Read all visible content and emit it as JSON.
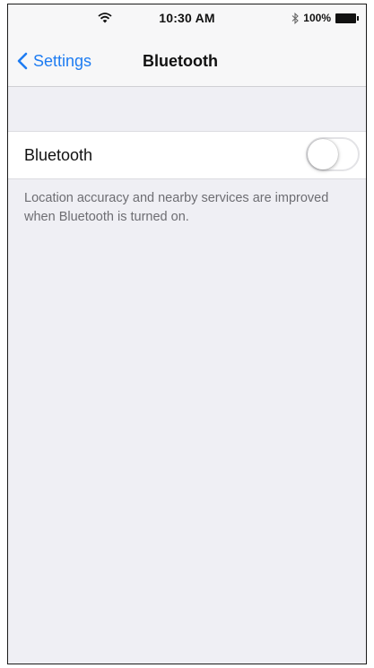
{
  "status_bar": {
    "time": "10:30 AM",
    "battery_label": "100%",
    "icons": [
      "wifi-icon",
      "bluetooth-icon",
      "battery-icon"
    ]
  },
  "nav": {
    "back_label": "Settings",
    "title": "Bluetooth"
  },
  "bluetooth_row": {
    "label": "Bluetooth",
    "toggle_state": "off"
  },
  "footer": {
    "note": "Location accuracy and nearby services are improved when Bluetooth is turned on."
  },
  "colors": {
    "accent": "#1e7cf2",
    "background": "#efeff4",
    "secondary_text": "#6d6d72"
  }
}
